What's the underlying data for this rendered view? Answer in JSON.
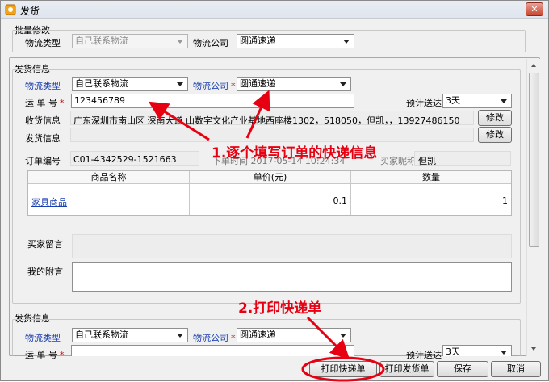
{
  "window": {
    "title": "发货"
  },
  "batch": {
    "group_label": "批量修改",
    "logistics_type_label": "物流类型",
    "logistics_type_value": "自己联系物流",
    "logistics_company_label": "物流公司",
    "logistics_company_value": "圆通速递"
  },
  "ship1": {
    "group_label": "发货信息",
    "logistics_type_label": "物流类型",
    "logistics_type_value": "自己联系物流",
    "logistics_company_label": "物流公司",
    "logistics_company_value": "圆通速递",
    "waybill_label": "运 单 号",
    "waybill_value": "123456789",
    "delivery_label": "预计送达",
    "delivery_value": "3天",
    "recv_label": "收货信息",
    "recv_value": "广东深圳市南山区 深南大道 山数字文化产业基地西座楼1302，518050，但凯，，13927486150",
    "ship_label": "发货信息",
    "edit_label": "修改",
    "order_no_label": "订单编号",
    "order_no_value": "C01-4342529-1521663",
    "order_time_partial": "下单时间 2017-05-14 10:24:34",
    "buyer_label_partial": "买家昵称",
    "buyer_value": "但凯",
    "table": {
      "headers": [
        "商品名称",
        "单价(元)",
        "数量"
      ],
      "rows": [
        {
          "name": "家具商品",
          "price": "0.1",
          "qty": "1"
        }
      ]
    },
    "buyer_msg_label": "买家留言",
    "note_label": "我的附言"
  },
  "ship2": {
    "group_label": "发货信息",
    "logistics_type_label": "物流类型",
    "logistics_type_value": "自己联系物流",
    "logistics_company_label": "物流公司",
    "logistics_company_value": "圆通速递",
    "waybill_label": "运 单 号",
    "delivery_label": "预计送达",
    "delivery_value": "3天"
  },
  "footer": {
    "print_express": "打印快递单",
    "print_invoice": "打印发货单",
    "save": "保存",
    "cancel": "取消"
  },
  "annotations": {
    "step1": "1.逐个填写订单的快递信息",
    "step2": "2.打印快递单"
  },
  "colors": {
    "annotation": "#e60012",
    "label_blue": "#1a3fb0"
  }
}
